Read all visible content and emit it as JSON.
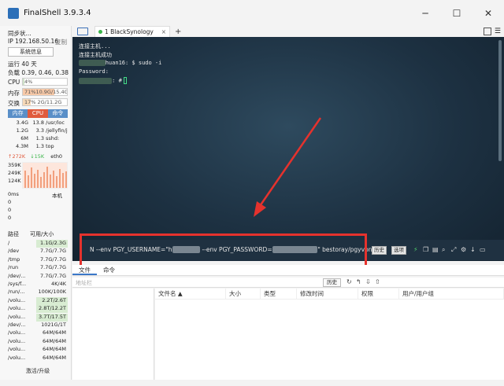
{
  "window": {
    "title": "FinalShell 3.9.3.4",
    "min": "─",
    "max": "☐",
    "close": "✕"
  },
  "sidebar": {
    "sync_label": "同步状...",
    "ip": "IP 192.168.50.16",
    "copy": "复制",
    "sysinfo_button": "系统信息",
    "uptime": "运行 40 天",
    "load": "负载 0.39, 0.46, 0.38",
    "cpu_label": "CPU",
    "cpu_value": "4%",
    "cpu_percent": 4,
    "mem_label": "内存",
    "mem_value": "71%10.9G/15.4G",
    "mem_percent": 71,
    "swap_label": "交换",
    "swap_value": "17%    2G/11.2G",
    "swap_percent": 17,
    "proc_tabs": [
      "内存",
      "CPU",
      "命令"
    ],
    "processes": [
      {
        "mem": "3.4G",
        "cpu": "13.8",
        "cmd": "/usr/loc"
      },
      {
        "mem": "1.2G",
        "cpu": "3.3",
        "cmd": "/jellyfin/j"
      },
      {
        "mem": "6M",
        "cpu": "1.3",
        "cmd": "sshd:"
      },
      {
        "mem": "4.3M",
        "cpu": "1.3",
        "cmd": "top"
      }
    ],
    "net_up": "↑272K",
    "net_down": "↓15K",
    "net_iface": "eth0",
    "net_scale": [
      "359K",
      "249K",
      "124K"
    ],
    "ping_label": "0ms",
    "ping_host": "本机",
    "ping_values": [
      "0",
      "0",
      "0"
    ],
    "disk_headers": [
      "路径",
      "可用/大小"
    ],
    "disks": [
      {
        "path": "/",
        "size": "1.1G/2.3G"
      },
      {
        "path": "/dev",
        "size": "7.7G/7.7G"
      },
      {
        "path": "/tmp",
        "size": "7.7G/7.7G"
      },
      {
        "path": "/run",
        "size": "7.7G/7.7G"
      },
      {
        "path": "/dev/...",
        "size": "7.7G/7.7G"
      },
      {
        "path": "/sys/f...",
        "size": "4K/4K"
      },
      {
        "path": "/run/...",
        "size": "100K/100K"
      },
      {
        "path": "/volu...",
        "size": "2.2T/2.6T"
      },
      {
        "path": "/volu...",
        "size": "2.8T/12.2T"
      },
      {
        "path": "/volu...",
        "size": "3.7T/17.5T"
      },
      {
        "path": "/dev/...",
        "size": "1021G/1T"
      },
      {
        "path": "/volu...",
        "size": "64M/64M"
      },
      {
        "path": "/volu...",
        "size": "64M/64M"
      },
      {
        "path": "/volu...",
        "size": "64M/64M"
      },
      {
        "path": "/volu...",
        "size": "64M/64M"
      }
    ],
    "upgrade": "激活/升级"
  },
  "tabs": {
    "active": "1 BlackSynology",
    "close": "×",
    "add": "+"
  },
  "terminal": {
    "lines": [
      "连接主机...",
      "连接主机成功"
    ],
    "prompt_tail": "huan16: $ sudo -i",
    "password": "Password:",
    "root_tail": ": #"
  },
  "cmdbar": {
    "text_a": "N --env PGY_USERNAME=\"h",
    "text_b": "--env PGY_PASSWORD=",
    "text_c": "\" bestoray/pgyvpn",
    "history": "历史",
    "options": "选项"
  },
  "bottom": {
    "tabs": [
      "文件",
      "命令"
    ],
    "path_placeholder": "地址栏",
    "history": "历史",
    "file_headers": [
      "文件名 ▲",
      "大小",
      "类型",
      "修改时间",
      "权限",
      "用户/用户组"
    ]
  },
  "colors": {
    "accent": "#3b78c8",
    "highlight": "#e5322d",
    "terminal_bg": "#1d3142"
  }
}
